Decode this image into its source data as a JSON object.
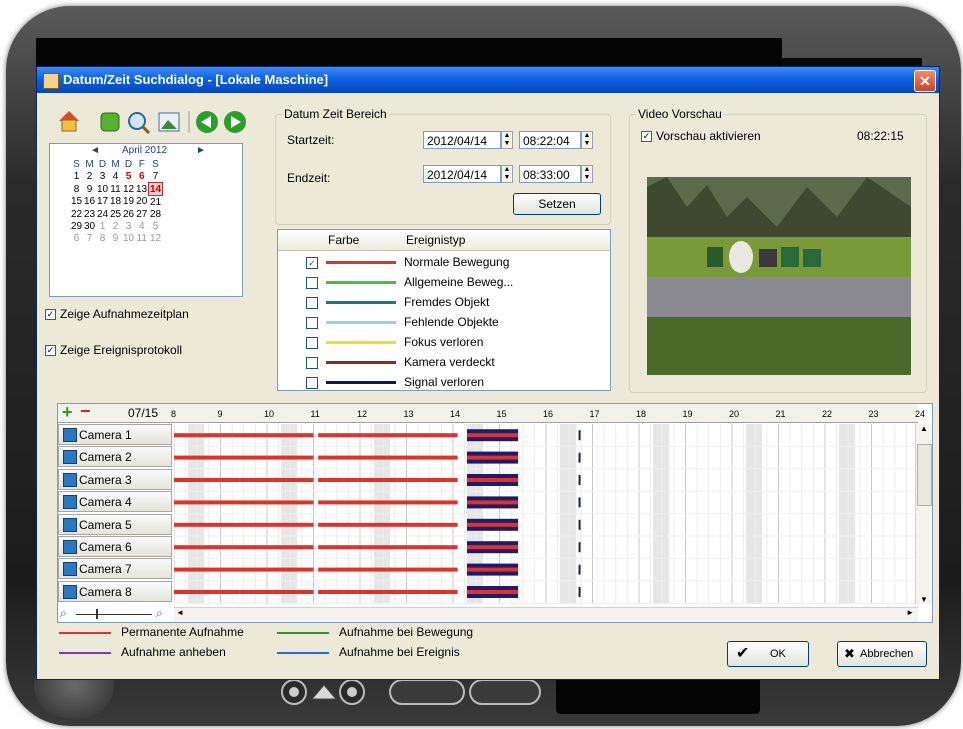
{
  "dialog": {
    "title": "Datum/Zeit Suchdialog - [Lokale Maschine]",
    "close_glyph": "✕"
  },
  "toolbar": {
    "icons": [
      "home-icon",
      "puzzle-icon",
      "search-icon",
      "image-icon",
      "back-icon",
      "forward-icon"
    ]
  },
  "calendar": {
    "month": "April 2012",
    "prev": "◄",
    "next": "►",
    "dow": [
      "S",
      "M",
      "D",
      "M",
      "D",
      "F",
      "S"
    ],
    "weeks": [
      [
        {
          "d": "1"
        },
        {
          "d": "2"
        },
        {
          "d": "3"
        },
        {
          "d": "4"
        },
        {
          "d": "5",
          "c": "red"
        },
        {
          "d": "6",
          "c": "red"
        },
        {
          "d": "7"
        }
      ],
      [
        {
          "d": "8"
        },
        {
          "d": "9"
        },
        {
          "d": "10"
        },
        {
          "d": "11"
        },
        {
          "d": "12"
        },
        {
          "d": "13"
        },
        {
          "d": "14",
          "c": "sel"
        }
      ],
      [
        {
          "d": "15"
        },
        {
          "d": "16"
        },
        {
          "d": "17"
        },
        {
          "d": "18"
        },
        {
          "d": "19"
        },
        {
          "d": "20"
        },
        {
          "d": "21"
        }
      ],
      [
        {
          "d": "22"
        },
        {
          "d": "23"
        },
        {
          "d": "24"
        },
        {
          "d": "25"
        },
        {
          "d": "26"
        },
        {
          "d": "27"
        },
        {
          "d": "28"
        }
      ],
      [
        {
          "d": "29"
        },
        {
          "d": "30"
        },
        {
          "d": "1",
          "c": "o"
        },
        {
          "d": "2",
          "c": "o"
        },
        {
          "d": "3",
          "c": "o"
        },
        {
          "d": "4",
          "c": "o"
        },
        {
          "d": "5",
          "c": "o"
        }
      ],
      [
        {
          "d": "6",
          "c": "o"
        },
        {
          "d": "7",
          "c": "o"
        },
        {
          "d": "8",
          "c": "o"
        },
        {
          "d": "9",
          "c": "o"
        },
        {
          "d": "10",
          "c": "o"
        },
        {
          "d": "11",
          "c": "o"
        },
        {
          "d": "12",
          "c": "o"
        }
      ]
    ]
  },
  "options": {
    "show_schedule": "Zeige Aufnahmezeitplan",
    "show_eventlog": "Zeige Ereignisprotokoll",
    "check_glyph": "✓"
  },
  "range": {
    "legend": "Datum Zeit Bereich",
    "start_label": "Startzeit:",
    "start_date": "2012/04/14",
    "start_time": "08:22:04",
    "end_label": "Endzeit:",
    "end_date": "2012/04/14",
    "end_time": "08:33:00",
    "set_button": "Setzen"
  },
  "events": {
    "col_color": "Farbe",
    "col_type": "Ereignistyp",
    "rows": [
      {
        "label": "Normale Bewegung",
        "color": "#e0322a",
        "checked": true
      },
      {
        "label": "Allgemeine Beweg...",
        "color": "#34c834",
        "checked": false
      },
      {
        "label": "Fremdes Objekt",
        "color": "#1a7a72",
        "checked": false
      },
      {
        "label": "Fehlende Objekte",
        "color": "#9ad0ee",
        "checked": false
      },
      {
        "label": "Fokus verloren",
        "color": "#f0e020",
        "checked": false
      },
      {
        "label": "Kamera verdeckt",
        "color": "#8a2a2a",
        "checked": false
      },
      {
        "label": "Signal verloren",
        "color": "#14145a",
        "checked": false
      }
    ]
  },
  "video": {
    "legend": "Video Vorschau",
    "enable_label": "Vorschau aktivieren",
    "time": "08:22:15"
  },
  "timeline": {
    "date": "07/15",
    "add_glyph": "+",
    "remove_glyph": "−",
    "hours": [
      "8",
      "9",
      "10",
      "11",
      "12",
      "13",
      "14",
      "15",
      "16",
      "17",
      "18",
      "19",
      "20",
      "21",
      "22",
      "23",
      "24"
    ],
    "cameras": [
      "Camera 1",
      "Camera 2",
      "Camera 3",
      "Camera 4",
      "Camera 5",
      "Camera 6",
      "Camera 7",
      "Camera 8"
    ],
    "zoom_out_glyph": "⌕",
    "zoom_in_glyph": "⌕",
    "scroll_left": "◄",
    "scroll_right": "►",
    "scroll_up": "▲",
    "scroll_down": "▼"
  },
  "legend": {
    "permanent": "Permanente Aufnahme",
    "motion": "Aufnahme bei Bewegung",
    "boost": "Aufnahme anheben",
    "event": "Aufnahme bei Ereignis",
    "colors": {
      "permanent": "#e0322a",
      "motion": "#2a9a2a",
      "boost": "#7a3ab8",
      "event": "#2a6ae0"
    }
  },
  "buttons": {
    "ok": "OK",
    "ok_glyph": "✔",
    "cancel": "Abbrechen",
    "cancel_glyph": "✖"
  }
}
